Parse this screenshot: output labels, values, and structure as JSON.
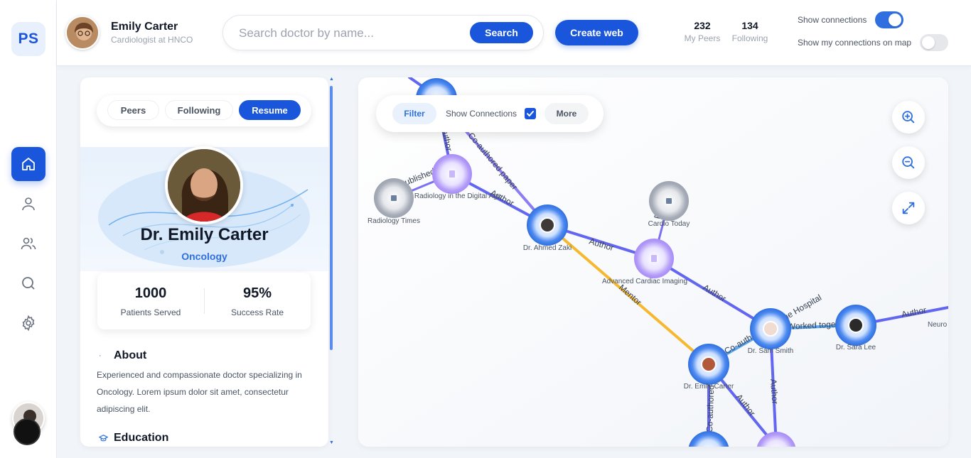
{
  "app": {
    "logo": "PS"
  },
  "sidebar": {
    "items": [
      {
        "name": "home-icon",
        "active": true
      },
      {
        "name": "user-icon",
        "active": false
      },
      {
        "name": "users-icon",
        "active": false
      },
      {
        "name": "search-icon",
        "active": false
      },
      {
        "name": "gear-icon",
        "active": false
      }
    ]
  },
  "header": {
    "user_name": "Emily Carter",
    "user_role": "Cardiologist at HNCO",
    "search_placeholder": "Search doctor by name...",
    "search_label": "Search",
    "create_label": "Create web",
    "peers_count": "232",
    "peers_label": "My Peers",
    "following_count": "134",
    "following_label": "Following",
    "toggle_connections_label": "Show connections",
    "toggle_connections_on": true,
    "toggle_map_label": "Show my connections on map",
    "toggle_map_on": false
  },
  "profile": {
    "tabs": [
      {
        "label": "Peers",
        "active": false
      },
      {
        "label": "Following",
        "active": false
      },
      {
        "label": "Resume",
        "active": true
      }
    ],
    "name": "Dr. Emily Carter",
    "specialty": "Oncology",
    "patients_value": "1000",
    "patients_label": "Patients Served",
    "success_value": "95%",
    "success_label": "Success Rate",
    "about_title": "About",
    "about_text": "Experienced and compassionate doctor specializing in Oncology. Lorem ipsum dolor sit amet, consectetur adipiscing elit.",
    "education_title": "Education"
  },
  "map": {
    "filter_label": "Filter",
    "show_connections_label": "Show Connections",
    "show_connections_checked": true,
    "more_label": "More",
    "nodes": [
      {
        "id": "radiology-times",
        "label": "Radiology Times",
        "kind": "journal"
      },
      {
        "id": "radiology-digital",
        "label": "Radiology in the Digital Age",
        "kind": "paper"
      },
      {
        "id": "ahmed-zaki",
        "label": "Dr. Ahmed Zaki",
        "kind": "doctor"
      },
      {
        "id": "cardio-today",
        "label": "Cardio Today",
        "kind": "journal"
      },
      {
        "id": "advanced-cardiac",
        "label": "Advanced Cardiac Imaging",
        "kind": "paper"
      },
      {
        "id": "sam-smith",
        "label": "Dr. Sam Smith",
        "kind": "doctor"
      },
      {
        "id": "sara-lee",
        "label": "Dr. Sara Lee",
        "kind": "doctor"
      },
      {
        "id": "emily-carter",
        "label": "Dr. Emily Carter",
        "kind": "doctor"
      },
      {
        "id": "neuro",
        "label": "Neuro",
        "kind": "paper"
      }
    ],
    "edge_labels": {
      "author": "Author",
      "coauthored": "Co-authored paper",
      "mentor": "Mentor",
      "published": "Published",
      "worked_together": "Worked together",
      "same_hospital": "Co-authored · Same Hospital"
    }
  },
  "colors": {
    "primary": "#1a56db",
    "accent": "#2f6fe0",
    "mentor_edge": "#f5b82e",
    "author_edge": "#6366f1",
    "paper_node": "#a78bfa",
    "journal_node": "#9ca3af"
  }
}
